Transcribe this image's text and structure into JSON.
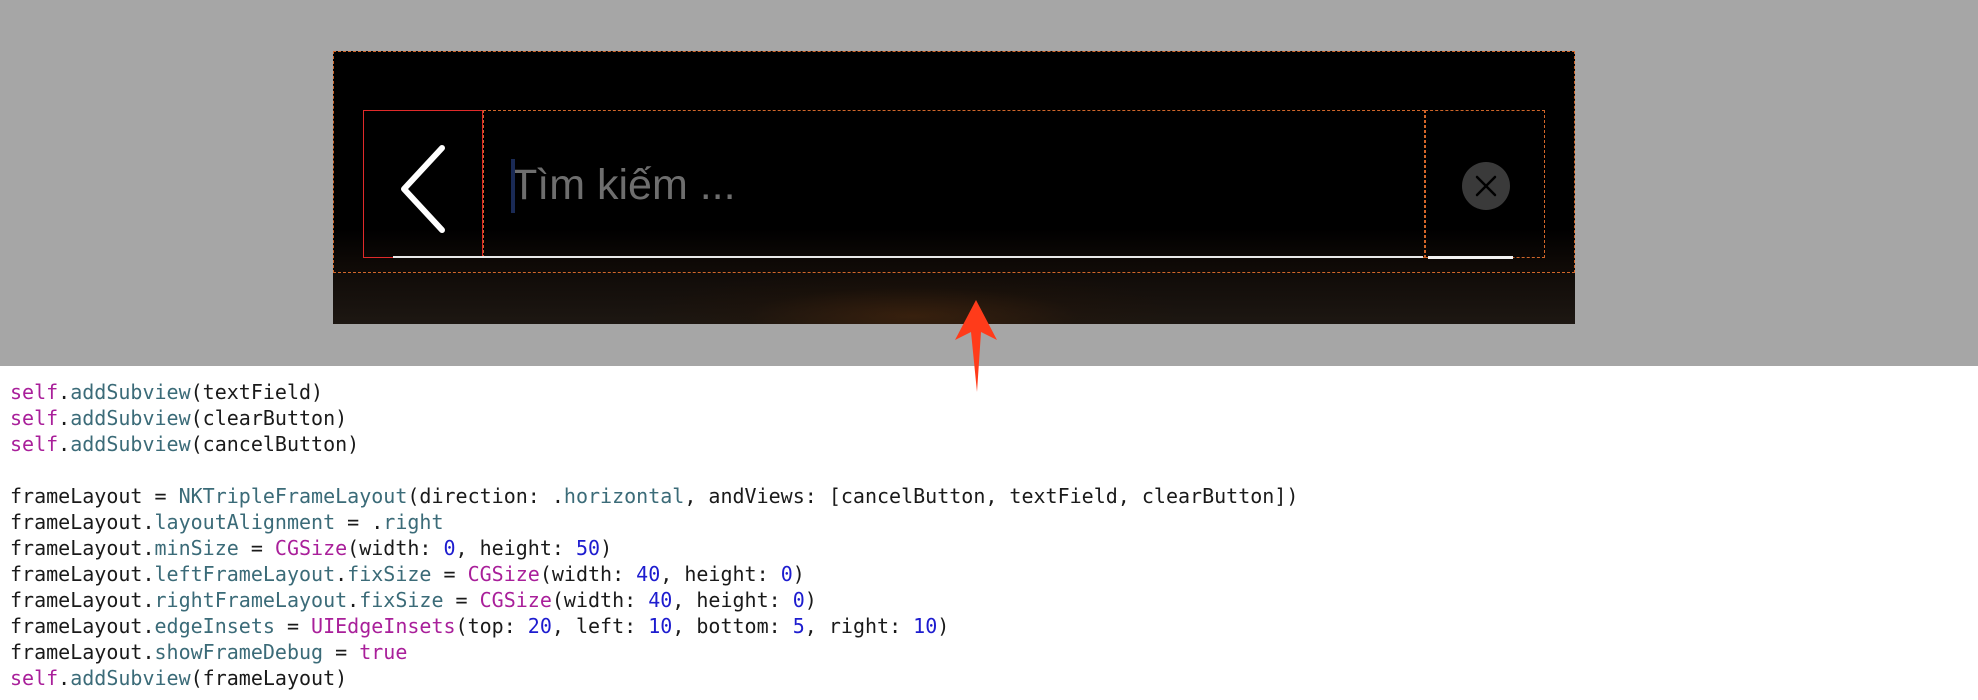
{
  "search_bar": {
    "placeholder": "Tìm kiếm ...",
    "back_icon": "chevron-left-icon",
    "clear_icon": "close-circle-icon"
  },
  "colors": {
    "preview_background": "#a6a6a6",
    "bar_background": "#000000",
    "debug_dashed": "#d0662a",
    "debug_solid": "#e02a2a",
    "arrow": "#ff3b1a",
    "keyword": "#a91f9a",
    "identifier": "#3b6b78",
    "number": "#1d1ccf"
  },
  "annotation_icon": "arrow-up-icon",
  "code": {
    "l1": {
      "a": "self",
      "b": ".",
      "c": "addSubview",
      "d": "(textField)"
    },
    "l2": {
      "a": "self",
      "b": ".",
      "c": "addSubview",
      "d": "(clearButton)"
    },
    "l3": {
      "a": "self",
      "b": ".",
      "c": "addSubview",
      "d": "(cancelButton)"
    },
    "l5": {
      "a": "frameLayout = ",
      "b": "NKTripleFrameLayout",
      "c": "(direction: .",
      "d": "horizontal",
      "e": ", andViews: [cancelButton, textField, clearButton])"
    },
    "l6": {
      "a": "frameLayout.",
      "b": "layoutAlignment",
      "c": " = .",
      "d": "right"
    },
    "l7": {
      "a": "frameLayout.",
      "b": "minSize",
      "c": " = ",
      "d": "CGSize",
      "e": "(width: ",
      "f": "0",
      "g": ", height: ",
      "h": "50",
      "i": ")"
    },
    "l8": {
      "a": "frameLayout.",
      "b": "leftFrameLayout",
      "c": ".",
      "d": "fixSize",
      "e": " = ",
      "f": "CGSize",
      "g": "(width: ",
      "h": "40",
      "i": ", height: ",
      "j": "0",
      "k": ")"
    },
    "l9": {
      "a": "frameLayout.",
      "b": "rightFrameLayout",
      "c": ".",
      "d": "fixSize",
      "e": " = ",
      "f": "CGSize",
      "g": "(width: ",
      "h": "40",
      "i": ", height: ",
      "j": "0",
      "k": ")"
    },
    "l10": {
      "a": "frameLayout.",
      "b": "edgeInsets",
      "c": " = ",
      "d": "UIEdgeInsets",
      "e": "(top: ",
      "f": "20",
      "g": ", left: ",
      "h": "10",
      "i": ", bottom: ",
      "j": "5",
      "k": ", right: ",
      "l": "10",
      "m": ")"
    },
    "l11": {
      "a": "frameLayout.",
      "b": "showFrameDebug",
      "c": " = ",
      "d": "true"
    },
    "l12": {
      "a": "self",
      "b": ".",
      "c": "addSubview",
      "d": "(frameLayout)"
    }
  }
}
